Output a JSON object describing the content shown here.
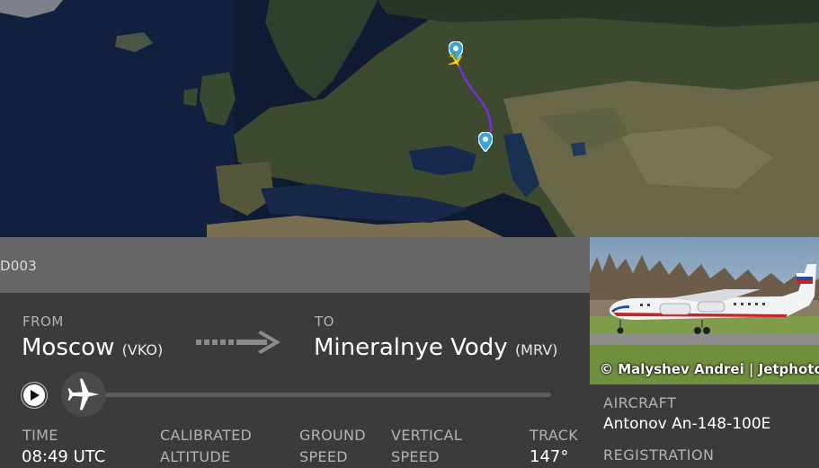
{
  "flight": {
    "callsign": "D003"
  },
  "route": {
    "from_label": "FROM",
    "from_city": "Moscow",
    "from_code": "(VKO)",
    "to_label": "TO",
    "to_city": "Mineralnye Vody",
    "to_code": "(MRV)"
  },
  "playback": {
    "progress_fraction": 0.03
  },
  "stats": [
    {
      "label": "TIME",
      "value": "08:49 UTC"
    },
    {
      "label": "CALIBRATED\nALTITUDE",
      "value": ""
    },
    {
      "label": "GROUND\nSPEED",
      "value": ""
    },
    {
      "label": "VERTICAL\nSPEED",
      "value": ""
    },
    {
      "label": "TRACK",
      "value": "147°"
    }
  ],
  "photo": {
    "credit": "© Malyshev Andrei | Jetphotos"
  },
  "aircraft": {
    "aircraft_label": "AIRCRAFT",
    "aircraft_value": "Antonov An-148-100E",
    "registration_label": "REGISTRATION"
  },
  "colors": {
    "route_line": "#7b2fd8",
    "map_pin": "#3aa3d6",
    "aircraft_icon": "#f5d118"
  },
  "icons": {
    "play": "play-icon",
    "plane": "plane-icon",
    "pin": "map-pin-icon",
    "arrow": "arrow-right-icon"
  }
}
